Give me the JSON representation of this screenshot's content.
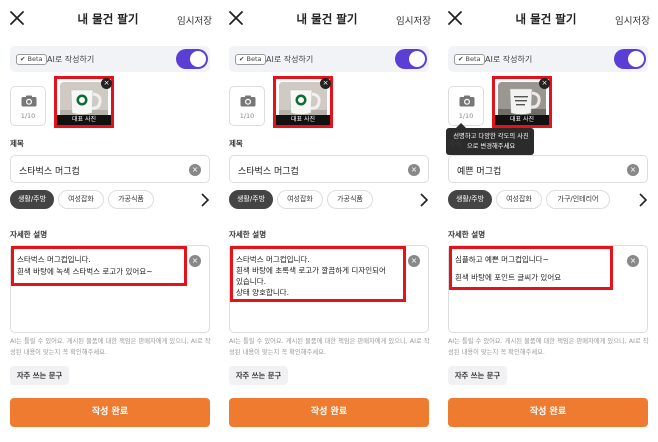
{
  "colors": {
    "accent": "#ef7b30",
    "highlight": "#e4121b",
    "toggle_on": "#5b3fd4"
  },
  "screens": [
    {
      "header": {
        "title": "내 물건 팔기",
        "save": "임시저장",
        "close_icon": "close-icon"
      },
      "ai": {
        "beta": "Beta",
        "label": "AI로 작성하기",
        "enabled": true
      },
      "photo": {
        "count": "1/10",
        "caption": "대표 사진",
        "content": "Starbucks mug"
      },
      "title_section": "제목",
      "title_value": "스타벅스 머그컵",
      "chips": [
        "생활/주방",
        "여성잡화",
        "가공식품"
      ],
      "desc_section": "자세한 설명",
      "desc_lines": [
        "스타벅스 머그컵입니다.",
        "흰색 바탕에 녹색 스타벅스 로고가 있어요~"
      ],
      "notice": "AI는 틀릴 수 있어요. 게시된 물품에 대한 책임은 판매자에게 있으니, AI로 작성된 내용이 맞는지 꼭 확인해주세요.",
      "freq_button": "자주 쓰는 문구",
      "submit": "작성 완료"
    },
    {
      "header": {
        "title": "내 물건 팔기",
        "save": "임시저장",
        "close_icon": "close-icon"
      },
      "ai": {
        "beta": "Beta",
        "label": "AI로 작성하기",
        "enabled": true
      },
      "photo": {
        "count": "1/10",
        "caption": "대표 사진",
        "content": "Starbucks mug"
      },
      "title_section": "제목",
      "title_value": "스타벅스 머그컵",
      "chips": [
        "생활/주방",
        "여성잡화",
        "가공식품"
      ],
      "desc_section": "자세한 설명",
      "desc_lines": [
        "스타벅스 머그컵입니다.",
        "흰색 바탕에 초록색 로고가 깔끔하게 디자인되어",
        "있습니다.",
        "상태 양호합니다."
      ],
      "notice": "AI는 틀릴 수 있어요. 게시된 물품에 대한 책임은 판매자에게 있으니, AI로 작성된 내용이 맞는지 꼭 확인해주세요.",
      "freq_button": "자주 쓰는 문구",
      "submit": "작성 완료"
    },
    {
      "header": {
        "title": "내 물건 팔기",
        "save": "임시저장",
        "close_icon": "close-icon"
      },
      "ai": {
        "beta": "Beta",
        "label": "AI로 작성하기",
        "enabled": true
      },
      "photo": {
        "count": "1/10",
        "caption": "대표 사진",
        "content": "white mug"
      },
      "tooltip": "선명하고 다양한 각도의 사진으로 변경해주세요",
      "title_section": "제목",
      "title_value": "예쁜 머그컵",
      "chips": [
        "생활/주방",
        "여성잡화",
        "가구/인테리어"
      ],
      "desc_section": "자세한 설명",
      "desc_lines": [
        "심플하고 예쁜 머그컵입니다~",
        "흰색 바탕에 포인트 글씨가 있어요"
      ],
      "notice": "AI는 틀릴 수 있어요. 게시된 물품에 대한 책임은 판매자에게 있으니, AI로 작성된 내용이 맞는지 꼭 확인해주세요.",
      "freq_button": "자주 쓰는 문구",
      "submit": "작성 완료"
    }
  ]
}
